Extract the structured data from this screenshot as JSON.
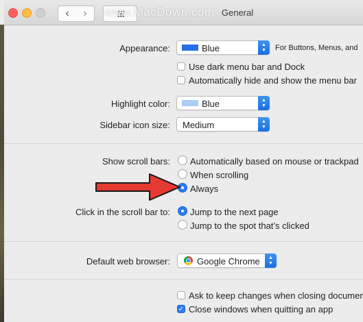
{
  "window": {
    "title": "General",
    "watermark": "www.MacDown.com"
  },
  "appearance": {
    "label": "Appearance:",
    "value": "Blue",
    "note": "For Buttons, Menus, and",
    "swatch_color": "#2a6be6"
  },
  "options": {
    "dark_menu": "Use dark menu bar and Dock",
    "auto_hide": "Automatically hide and show the menu bar"
  },
  "highlight": {
    "label": "Highlight color:",
    "value": "Blue",
    "swatch_color": "#a9cdf3"
  },
  "sidebar_icon": {
    "label": "Sidebar icon size:",
    "value": "Medium"
  },
  "scroll_bars": {
    "label": "Show scroll bars:",
    "options": [
      "Automatically based on mouse or trackpad",
      "When scrolling",
      "Always"
    ],
    "selected": "Always"
  },
  "click_scroll": {
    "label": "Click in the scroll bar to:",
    "options": [
      "Jump to the next page",
      "Jump to the spot that’s clicked"
    ],
    "selected": "Jump to the next page"
  },
  "browser": {
    "label": "Default web browser:",
    "value": "Google Chrome"
  },
  "bottom": {
    "ask_keep": "Ask to keep changes when closing documents",
    "close_windows": "Close windows when quitting an app",
    "ask_keep_checked": false,
    "close_windows_checked": true
  },
  "colors": {
    "accent": "#2d7bf0",
    "arrow": "#e53a32"
  }
}
